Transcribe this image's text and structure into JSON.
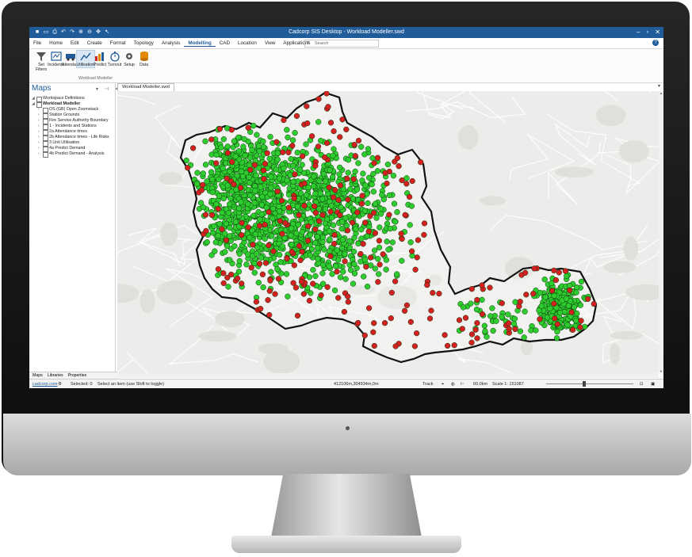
{
  "app": {
    "title": "Cadcorp SIS Desktop - Workload Modeller.swd"
  },
  "menu": {
    "tabs": [
      "File",
      "Home",
      "Edit",
      "Create",
      "Format",
      "Topology",
      "Analysis",
      "Modelling",
      "CAD",
      "Location",
      "View",
      "Applications"
    ],
    "selected": "Modelling",
    "search_placeholder": "Search"
  },
  "ribbon": {
    "buttons": [
      {
        "label": "Set Filters",
        "icon": "filter-icon"
      },
      {
        "label": "Incidents",
        "icon": "incidents-icon"
      },
      {
        "label": "Attendance",
        "icon": "fire-engine-icon"
      },
      {
        "label": "Utilisation",
        "icon": "line-chart-icon"
      },
      {
        "label": "Predict",
        "icon": "bar-chart-icon"
      },
      {
        "label": "Turnout",
        "icon": "stopwatch-icon"
      },
      {
        "label": "Setup",
        "icon": "gear-icon"
      },
      {
        "label": "Data",
        "icon": "database-icon"
      }
    ],
    "selected": "Utilisation",
    "group_label": "Workload Modeller"
  },
  "maps_panel": {
    "title": "Maps",
    "items": [
      {
        "label": "Workspace Definitions",
        "level": 0
      },
      {
        "label": "Workload Modeller",
        "level": 0
      },
      {
        "label": "OS (GB) Open Zoomstack",
        "level": 1
      },
      {
        "label": "Station Grounds",
        "level": 1
      },
      {
        "label": "Fire Service Authority Boundary",
        "level": 1
      },
      {
        "label": "1 - Incidents and Stations",
        "level": 1
      },
      {
        "label": "2a Attendance times",
        "level": 1
      },
      {
        "label": "2b Attendance times - Life Risks",
        "level": 1
      },
      {
        "label": "3 Unit Utilisation",
        "level": 1
      },
      {
        "label": "4a Predict Demand",
        "level": 1
      },
      {
        "label": "4b Predict Demand - Analysis",
        "level": 1
      }
    ],
    "tabs": [
      "Maps",
      "Libraries",
      "Properties"
    ]
  },
  "document": {
    "tab": "Workload Modeller.swd"
  },
  "status": {
    "link": "cadcorp.com",
    "selected": "Selected: 0",
    "hint": "Select an item (use Shift to toggle)",
    "coords": "412106m,304934m,0m",
    "track": "Track",
    "scale_distance": "60.0km",
    "scale": "Scale 1: 151087"
  },
  "colors": {
    "title_bar": "#1f5c99",
    "accent": "#1f5c99",
    "incident_green": "#2ecc2e",
    "incident_red": "#d32020",
    "boundary": "#111111"
  }
}
